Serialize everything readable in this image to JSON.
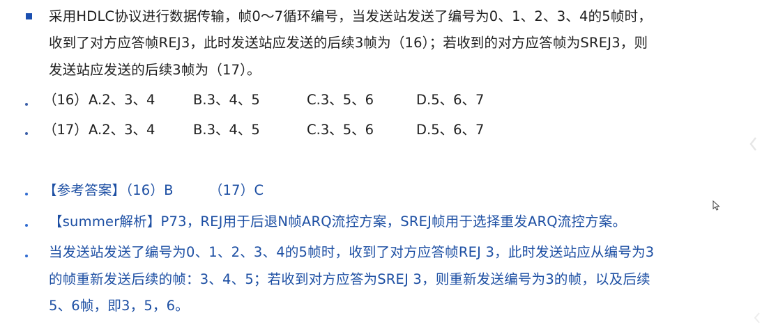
{
  "question": {
    "lines": [
      "采用HDLC协议进行数据传输，帧0～7循环编号，当发送站发送了编号为0、1、2、3、4的5帧时，",
      "收到了对方应答帧REJ3，此时发送站应发送的后续3帧为（16）；若收到的对方应答帧为SREJ3，则",
      "发送站应发送的后续3帧为（17）。"
    ]
  },
  "options": [
    {
      "label": "（16）",
      "a": "A.2、3、4",
      "b": "B.3、4、5",
      "c": "C.3、5、6",
      "d": "D.5、6、7"
    },
    {
      "label": "（17）",
      "a": "A.2、3、4",
      "b": "B.3、4、5",
      "c": "C.3、5、6",
      "d": "D.5、6、7"
    }
  ],
  "answer": {
    "text": "【参考答案】（16）B        （17）C"
  },
  "analysis": {
    "title_line": "【summer解析】P73，REJ用于后退N帧ARQ流控方案，SREJ帧用于选择重发ARQ流控方案。",
    "detail_lines": [
      "当发送站发送了编号为0、1、2、3、4的5帧时，收到了对方应答帧REJ 3，此时发送站应从编号为3",
      "的帧重新发送后续的帧：3、4、5；若收到对方应答为SREJ 3，则重新发送编号为3的帧，以及后续",
      "5、6帧，即3，5，6。"
    ]
  },
  "colors": {
    "question_text": "#202020",
    "answer_text": "#1d4fa3",
    "square_bullet": "#1a4fb0",
    "dot_bullet_dark": "#3a5fa8",
    "dot_bullet_blue": "#2f6bd0"
  },
  "icons": [
    "square-bullet-icon",
    "dot-bullet-icon",
    "mouse-cursor-icon",
    "chevron-left-icon"
  ]
}
